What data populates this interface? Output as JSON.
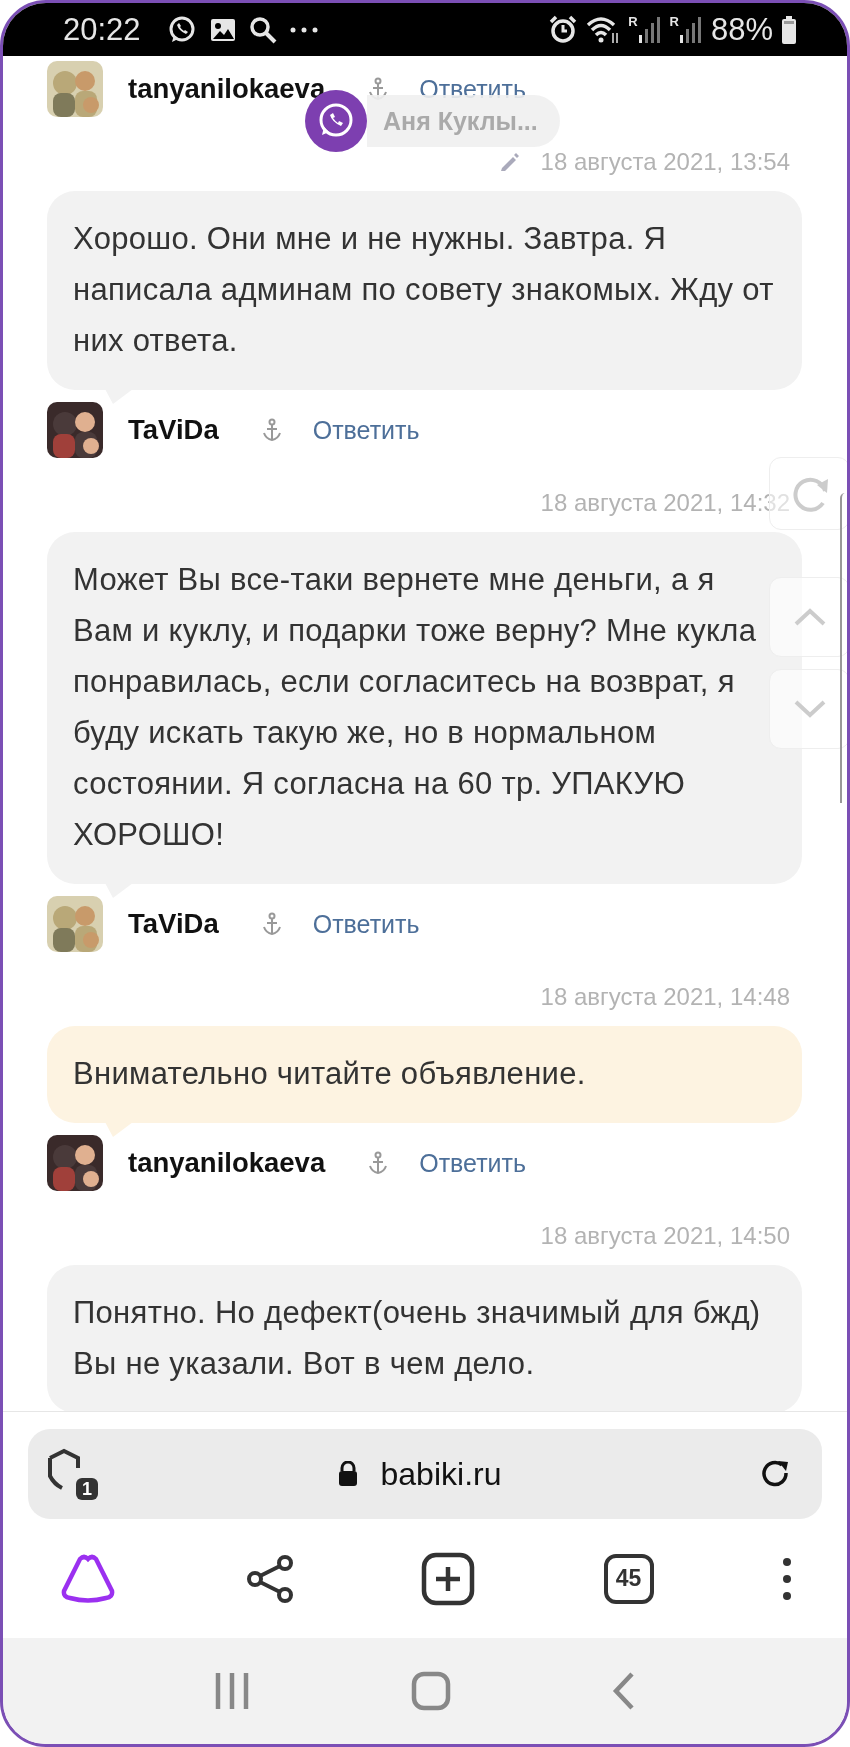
{
  "status_bar": {
    "time": "20:22",
    "signals": [
      {
        "roaming": "R"
      },
      {
        "roaming": "R"
      }
    ],
    "battery": "88%"
  },
  "feed": [
    {
      "kind": "author",
      "name": "tanyanilokaeva",
      "reply": "Ответить"
    },
    {
      "kind": "message",
      "date": "18 августа 2021, 13:54",
      "edited": true,
      "highlighted": false,
      "text": "Хорошо. Они мне и не нужны. Завтра. Я написала админам по совету знакомых. Жду от них ответа."
    },
    {
      "kind": "author",
      "name": "TaViDa",
      "reply": "Ответить"
    },
    {
      "kind": "message",
      "date": "18 августа 2021, 14:32",
      "edited": false,
      "highlighted": false,
      "text": "Может Вы все-таки вернете мне деньги, а я Вам и куклу, и подарки тоже верну? Мне кукла понравилась, если согласитесь на возврат, я буду искать такую же, но в нормальном состоянии. Я согласна на 60 тр. УПАКУЮ ХОРОШО!"
    },
    {
      "kind": "author",
      "name": "TaViDa",
      "reply": "Ответить"
    },
    {
      "kind": "message",
      "date": "18 августа 2021, 14:48",
      "edited": false,
      "highlighted": true,
      "text": "Внимательно читайте объявление."
    },
    {
      "kind": "author",
      "name": "tanyanilokaeva",
      "reply": "Ответить"
    },
    {
      "kind": "message",
      "date": "18 августа 2021, 14:50",
      "edited": false,
      "highlighted": false,
      "text": "Понятно. Но дефект(очень значимый для бжд) Вы не указали. Вот в чем дело."
    }
  ],
  "chat_bubble": {
    "label": "Аня Куклы..."
  },
  "address_bar": {
    "shield_count": "1",
    "url": "babiki.ru"
  },
  "toolbar": {
    "tabs_count": "45"
  }
}
